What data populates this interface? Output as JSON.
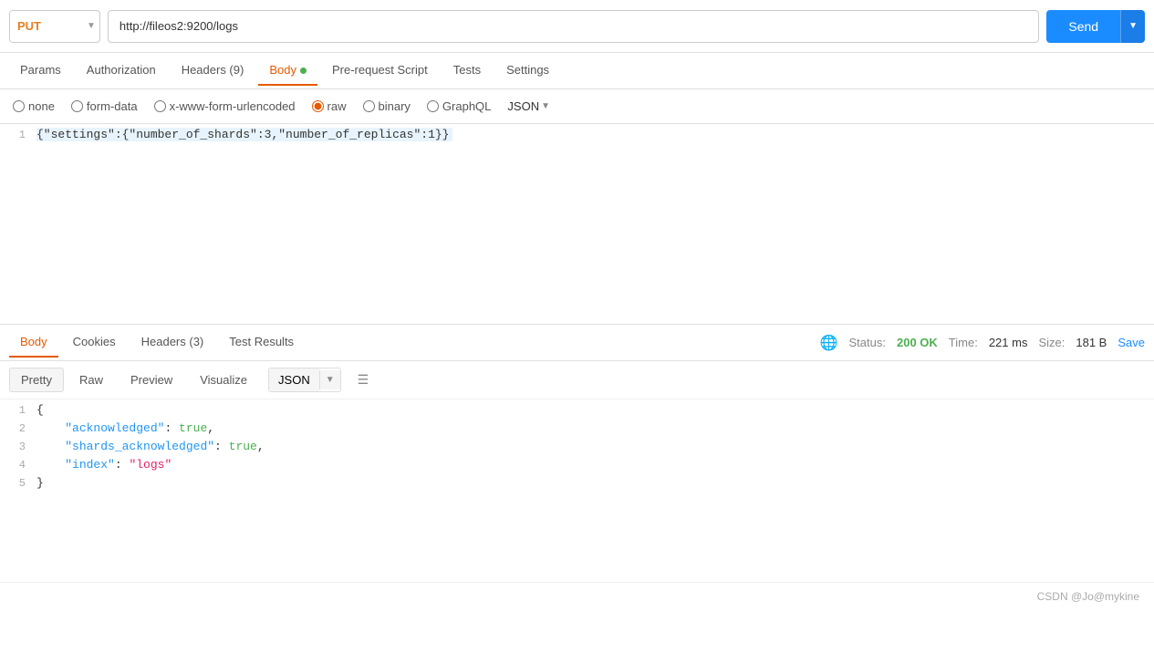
{
  "toolbar": {
    "method": "PUT",
    "url": "http://fileos2:9200/logs",
    "send_label": "Send",
    "send_dropdown_arrow": "▼"
  },
  "request_tabs": [
    {
      "id": "params",
      "label": "Params",
      "active": false,
      "has_dot": false
    },
    {
      "id": "authorization",
      "label": "Authorization",
      "active": false,
      "has_dot": false
    },
    {
      "id": "headers",
      "label": "Headers (9)",
      "active": false,
      "has_dot": false
    },
    {
      "id": "body",
      "label": "Body",
      "active": true,
      "has_dot": true
    },
    {
      "id": "pre-request-script",
      "label": "Pre-request Script",
      "active": false,
      "has_dot": false
    },
    {
      "id": "tests",
      "label": "Tests",
      "active": false,
      "has_dot": false
    },
    {
      "id": "settings",
      "label": "Settings",
      "active": false,
      "has_dot": false
    }
  ],
  "body_types": [
    {
      "id": "none",
      "label": "none",
      "checked": false
    },
    {
      "id": "form-data",
      "label": "form-data",
      "checked": false
    },
    {
      "id": "x-www-form-urlencoded",
      "label": "x-www-form-urlencoded",
      "checked": false
    },
    {
      "id": "raw",
      "label": "raw",
      "checked": true
    },
    {
      "id": "binary",
      "label": "binary",
      "checked": false
    },
    {
      "id": "graphql",
      "label": "GraphQL",
      "checked": false
    }
  ],
  "json_format_label": "JSON",
  "request_body_line": "{\"settings\":{\"number_of_shards\":3,\"number_of_replicas\":1}}",
  "response_tabs": [
    {
      "id": "body",
      "label": "Body",
      "active": true
    },
    {
      "id": "cookies",
      "label": "Cookies",
      "active": false
    },
    {
      "id": "headers",
      "label": "Headers (3)",
      "active": false
    },
    {
      "id": "test-results",
      "label": "Test Results",
      "active": false
    }
  ],
  "response_meta": {
    "status_label": "Status:",
    "status_value": "200 OK",
    "time_label": "Time:",
    "time_value": "221 ms",
    "size_label": "Size:",
    "size_value": "181 B",
    "save_label": "Save"
  },
  "response_format_tabs": [
    {
      "id": "pretty",
      "label": "Pretty",
      "active": true
    },
    {
      "id": "raw",
      "label": "Raw",
      "active": false
    },
    {
      "id": "preview",
      "label": "Preview",
      "active": false
    },
    {
      "id": "visualize",
      "label": "Visualize",
      "active": false
    }
  ],
  "response_json_label": "JSON",
  "response_lines": [
    {
      "num": 1,
      "content": "{"
    },
    {
      "num": 2,
      "content": "    \"acknowledged\": true,"
    },
    {
      "num": 3,
      "content": "    \"shards_acknowledged\": true,"
    },
    {
      "num": 4,
      "content": "    \"index\": \"logs\""
    },
    {
      "num": 5,
      "content": "}"
    }
  ],
  "footer": {
    "credit": "CSDN @Jo@mykine"
  }
}
